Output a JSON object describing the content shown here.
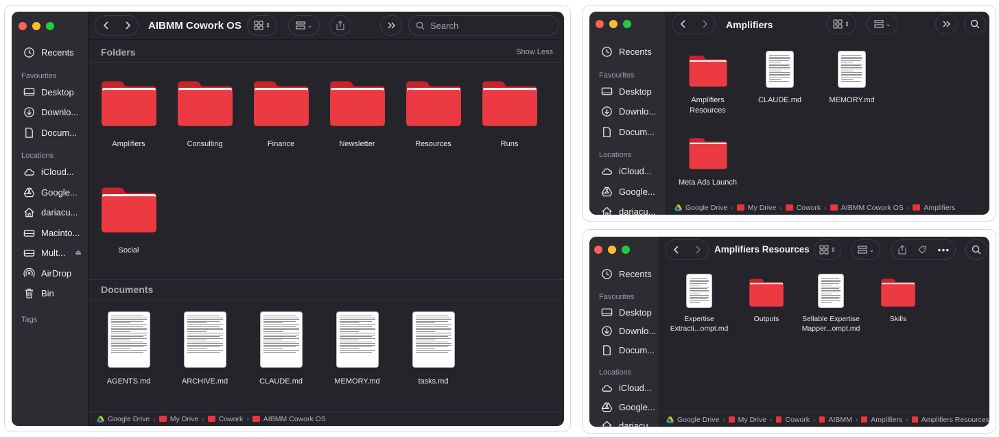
{
  "icons": {
    "recents": "clock-icon",
    "desktop": "desktop-icon",
    "downloads": "download-icon",
    "documents": "document-icon",
    "icloud": "cloud-icon",
    "google": "google-drive-icon",
    "home": "home-icon",
    "disk": "disk-icon",
    "airdrop": "airdrop-icon",
    "bin": "trash-icon",
    "folder": "folder-icon",
    "file": "markdown-file-icon"
  },
  "colors": {
    "folder": "#e8343c",
    "window_bg": "#25242b",
    "sidebar_bg": "#2d2c33"
  },
  "main": {
    "title": "AIBMM Cowork OS",
    "search_placeholder": "Search",
    "sidebar": {
      "recents": "Recents",
      "favourites_label": "Favourites",
      "favourites": [
        "Desktop",
        "Downlo...",
        "Docum..."
      ],
      "locations_label": "Locations",
      "locations": [
        "iCloud...",
        "Google...",
        "dariacu...",
        "Macinto...",
        "Mult...",
        "AirDrop",
        "Bin"
      ],
      "tags_label": "Tags"
    },
    "folders_header": "Folders",
    "show_less": "Show Less",
    "folders": [
      "Amplifiers",
      "Consulting",
      "Finance",
      "Newsletter",
      "Resources",
      "Runs",
      "Social"
    ],
    "documents_header": "Documents",
    "documents": [
      "AGENTS.md",
      "ARCHIVE.md",
      "CLAUDE.md",
      "MEMORY.md",
      "tasks.md"
    ],
    "path": [
      "Google Drive",
      "My Drive",
      "Cowork",
      "AIBMM Cowork OS"
    ]
  },
  "amp": {
    "title": "Amplifiers",
    "sidebar": {
      "recents": "Recents",
      "favourites_label": "Favourites",
      "favourites": [
        "Desktop",
        "Downlo...",
        "Docum..."
      ],
      "locations_label": "Locations",
      "locations": [
        "iCloud...",
        "Google...",
        "dariacu..."
      ]
    },
    "items": [
      {
        "type": "folder",
        "name": "Amplifiers\nResources"
      },
      {
        "type": "file",
        "name": "CLAUDE.md"
      },
      {
        "type": "file",
        "name": "MEMORY.md"
      },
      {
        "type": "folder",
        "name": "Meta Ads Launch"
      }
    ],
    "path": [
      "Google Drive",
      "My Drive",
      "Cowork",
      "AIBMM Cowork OS",
      "Amplifiers"
    ]
  },
  "ampres": {
    "title": "Amplifiers Resources",
    "sidebar": {
      "recents": "Recents",
      "favourites_label": "Favourites",
      "favourites": [
        "Desktop",
        "Downlo...",
        "Docum..."
      ],
      "locations_label": "Locations",
      "locations": [
        "iCloud...",
        "Google...",
        "dariacu..."
      ]
    },
    "items": [
      {
        "type": "file",
        "name": "Expertise\nExtracti...ompt.md"
      },
      {
        "type": "folder",
        "name": "Outputs"
      },
      {
        "type": "file",
        "name": "Sellable Expertise\nMapper...ompt.md"
      },
      {
        "type": "folder",
        "name": "Skills"
      }
    ],
    "path": [
      "Google Drive",
      "My Drive",
      "Cowork",
      "AIBMM",
      "Amplifiers",
      "Amplifiers Resources"
    ]
  }
}
